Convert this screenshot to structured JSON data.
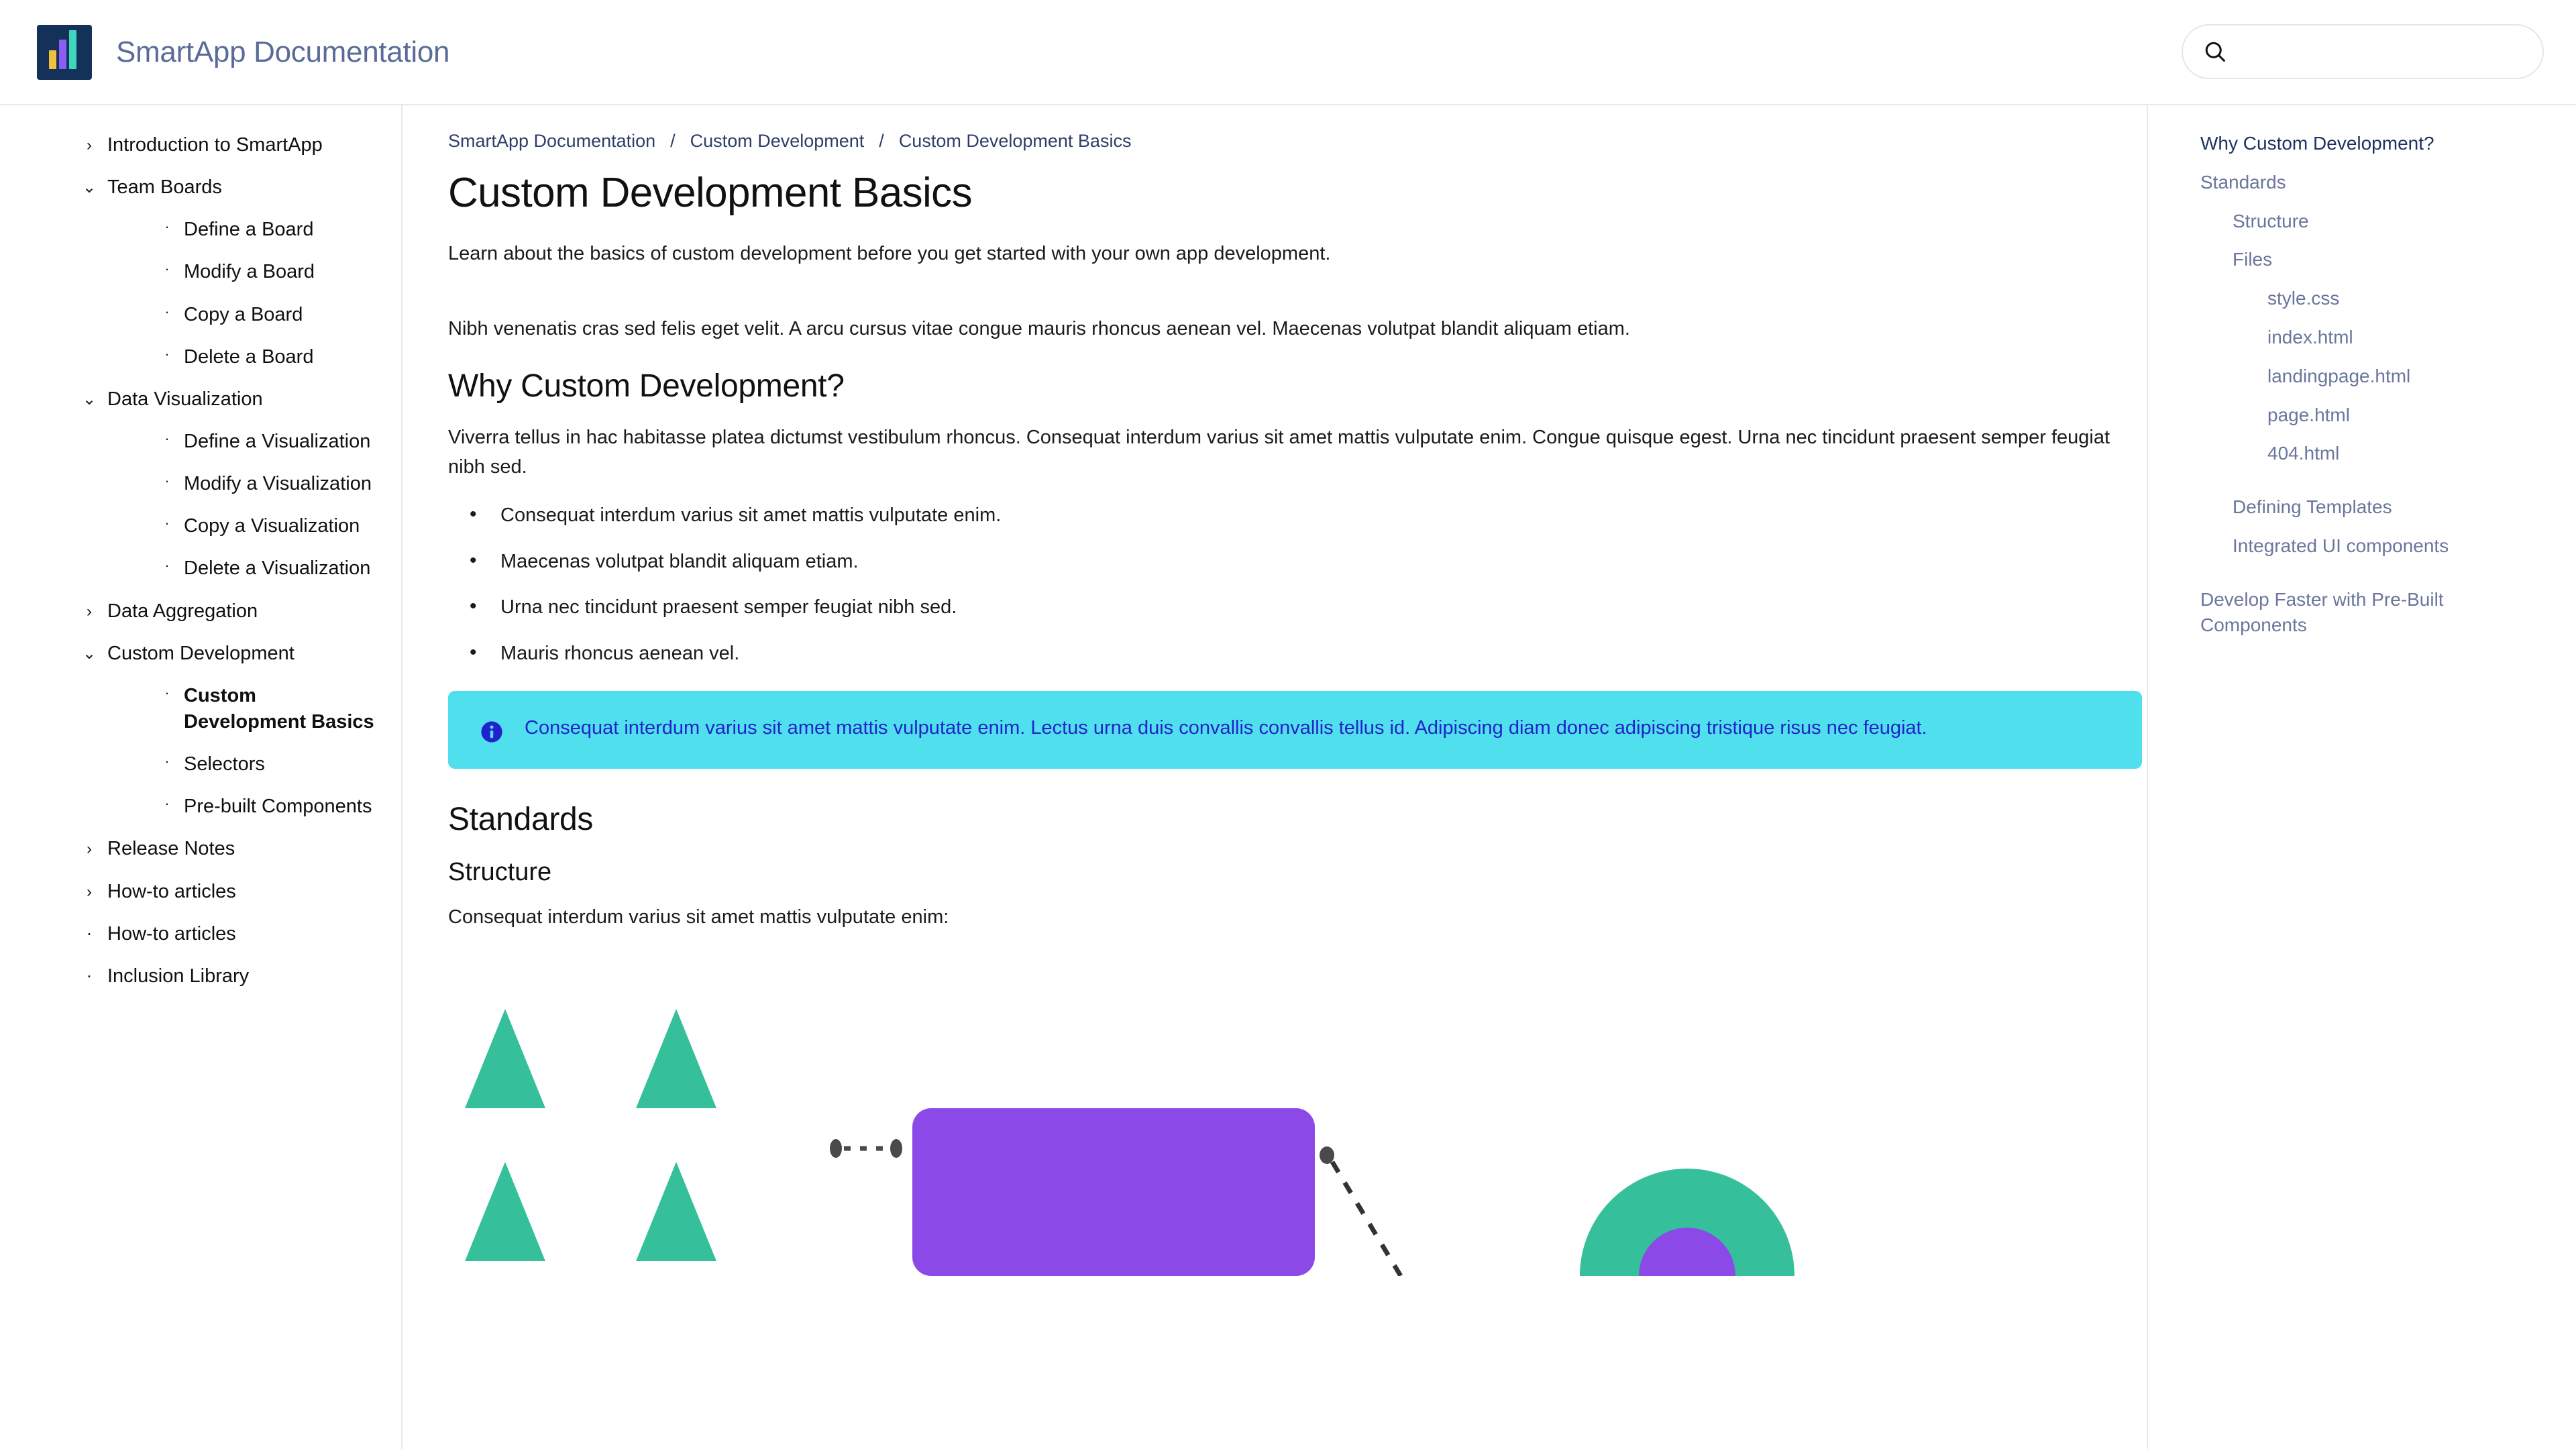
{
  "header": {
    "brand_title": "SmartApp Documentation",
    "logo_name": "bar-chart-logo",
    "search": {
      "value": "",
      "placeholder": "",
      "icon": "search-icon"
    }
  },
  "sidebar": {
    "items": [
      {
        "label": "Introduction to SmartApp",
        "depth": 0,
        "marker": "chevron-right",
        "active": false
      },
      {
        "label": "Team Boards",
        "depth": 0,
        "marker": "chevron-down",
        "active": false
      },
      {
        "label": "Define a Board",
        "depth": 1,
        "marker": "dot",
        "active": false
      },
      {
        "label": "Modify a Board",
        "depth": 1,
        "marker": "dot",
        "active": false
      },
      {
        "label": "Copy a Board",
        "depth": 1,
        "marker": "dot",
        "active": false
      },
      {
        "label": "Delete a Board",
        "depth": 1,
        "marker": "dot",
        "active": false
      },
      {
        "label": "Data Visualization",
        "depth": 0,
        "marker": "chevron-down",
        "active": false
      },
      {
        "label": "Define a Visualization",
        "depth": 1,
        "marker": "dot",
        "active": false
      },
      {
        "label": "Modify a Visualization",
        "depth": 1,
        "marker": "dot",
        "active": false
      },
      {
        "label": "Copy a Visualization",
        "depth": 1,
        "marker": "dot",
        "active": false
      },
      {
        "label": "Delete a Visualization",
        "depth": 1,
        "marker": "dot",
        "active": false
      },
      {
        "label": "Data Aggregation",
        "depth": 0,
        "marker": "chevron-right",
        "active": false
      },
      {
        "label": "Custom Development",
        "depth": 0,
        "marker": "chevron-down",
        "active": false
      },
      {
        "label": "Custom Development Basics",
        "depth": 1,
        "marker": "dot",
        "active": true
      },
      {
        "label": "Selectors",
        "depth": 1,
        "marker": "dot",
        "active": false
      },
      {
        "label": "Pre-built Components",
        "depth": 1,
        "marker": "dot",
        "active": false
      },
      {
        "label": "Release Notes",
        "depth": 0,
        "marker": "chevron-right",
        "active": false
      },
      {
        "label": "How-to articles",
        "depth": 0,
        "marker": "chevron-right",
        "active": false
      },
      {
        "label": "How-to articles",
        "depth": 0,
        "marker": "dot",
        "active": false
      },
      {
        "label": "Inclusion Library",
        "depth": 0,
        "marker": "dot",
        "active": false
      }
    ]
  },
  "main": {
    "breadcrumb": [
      "SmartApp Documentation",
      "Custom Development",
      "Custom Development Basics"
    ],
    "breadcrumb_separator": "/",
    "page_title": "Custom Development Basics",
    "lead": "Learn about the basics of custom development before you get started with your own app development.",
    "intro_paragraph": "Nibh venenatis cras sed felis eget velit. A arcu cursus vitae congue mauris rhoncus aenean vel. Maecenas volutpat blandit aliquam etiam.",
    "section_why": {
      "heading": "Why Custom Development?",
      "paragraph": "Viverra tellus in hac habitasse platea dictumst vestibulum rhoncus. Consequat interdum varius sit amet mattis vulputate enim. Congue quisque egest. Urna nec tincidunt praesent semper feugiat nibh sed.",
      "bullets": [
        "Consequat interdum varius sit amet mattis vulputate enim.",
        "Maecenas volutpat blandit aliquam etiam.",
        "Urna nec tincidunt praesent semper feugiat nibh sed.",
        "Mauris rhoncus aenean vel."
      ]
    },
    "callout": {
      "icon": "info-icon",
      "text": "Consequat interdum varius sit amet mattis vulputate enim. Lectus urna duis convallis convallis tellus id. Adipiscing diam donec adipiscing tristique risus nec feugiat.",
      "background": "#4fdfed",
      "text_color": "#2222cc"
    },
    "section_standards": {
      "heading": "Standards",
      "subheading": "Structure",
      "paragraph": "Consequat interdum varius sit amet mattis vulputate enim:"
    },
    "diagram": {
      "name": "structure-diagram",
      "teal": "#35bf9b",
      "purple": "#8b4ae8",
      "connector": "#4a4a4a"
    }
  },
  "toc": {
    "items": [
      {
        "label": "Why Custom Development?",
        "level": 0,
        "active": true
      },
      {
        "label": "Standards",
        "level": 0,
        "active": false
      },
      {
        "label": "Structure",
        "level": 1,
        "active": false
      },
      {
        "label": "Files",
        "level": 1,
        "active": false
      },
      {
        "label": "style.css",
        "level": 2,
        "active": false
      },
      {
        "label": "index.html",
        "level": 2,
        "active": false
      },
      {
        "label": "landingpage.html",
        "level": 2,
        "active": false
      },
      {
        "label": "page.html",
        "level": 2,
        "active": false
      },
      {
        "label": "404.html",
        "level": 2,
        "active": false
      },
      {
        "label": "Defining Templates",
        "level": 1,
        "active": false
      },
      {
        "label": "Integrated UI components",
        "level": 1,
        "active": false
      },
      {
        "label": "Develop Faster with Pre-Built Components",
        "level": 0,
        "active": false
      }
    ]
  }
}
